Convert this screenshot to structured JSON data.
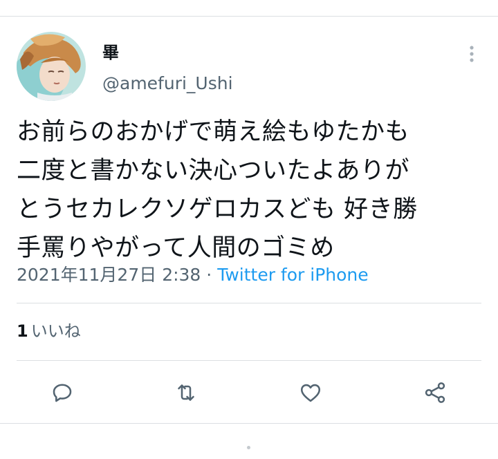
{
  "tweet": {
    "author": {
      "display_name": "畢",
      "handle": "@amefuri_Ushi",
      "avatar_icon": "avatar-illustration"
    },
    "text_lines": [
      "お前らのおかげで萌え絵もゆたかも",
      "二度と書かない決心ついたよありが",
      "とうセカレクソゲロカスども 好き勝",
      "手罵りやがって人間のゴミめ"
    ],
    "timestamp": "2021年11月27日 2:38",
    "separator": " · ",
    "source": "Twitter for iPhone",
    "likes": {
      "count": "1",
      "label": "いいね"
    }
  },
  "actions": {
    "reply_icon": "reply-icon",
    "retweet_icon": "retweet-icon",
    "like_icon": "heart-icon",
    "share_icon": "share-icon",
    "more_icon": "more-vertical-icon"
  },
  "colors": {
    "text": "#0f1419",
    "secondary": "#536471",
    "link": "#1d9bf0",
    "divider": "#dcdfe2"
  }
}
